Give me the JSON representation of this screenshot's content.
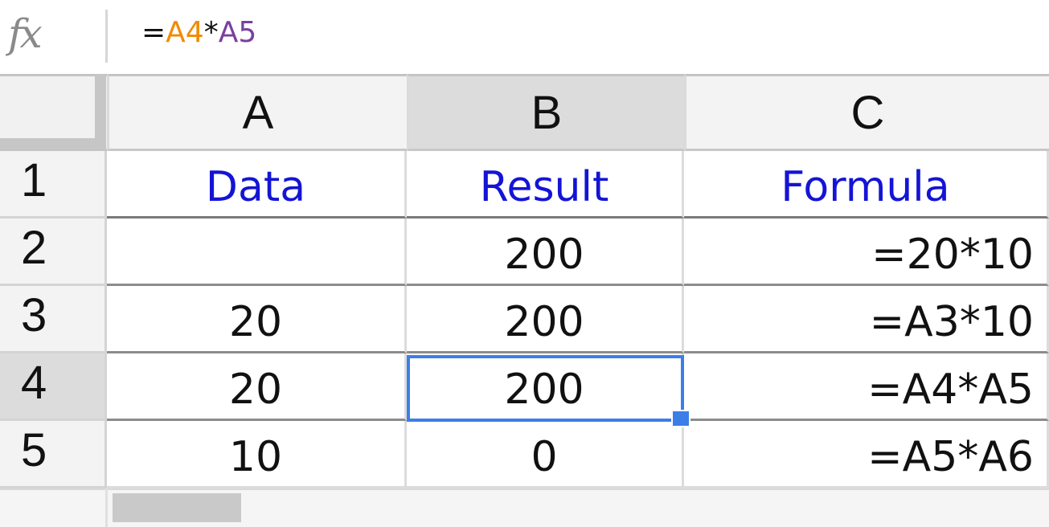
{
  "formula_bar": {
    "icon": "fx-icon",
    "tokens": [
      {
        "text": "=",
        "color": "#111111"
      },
      {
        "text": "A4",
        "color": "#f08a00"
      },
      {
        "text": "*",
        "color": "#111111"
      },
      {
        "text": "A5",
        "color": "#7b3fa0"
      }
    ]
  },
  "columns": [
    "A",
    "B",
    "C"
  ],
  "rows": [
    "1",
    "2",
    "3",
    "4",
    "5"
  ],
  "cells": {
    "A1": "Data",
    "B1": "Result",
    "C1": "Formula",
    "A2": "",
    "B2": "200",
    "C2": "=20*10",
    "A3": "20",
    "B3": "200",
    "C3": "=A3*10",
    "A4": "20",
    "B4": "200",
    "C4": "=A4*A5",
    "A5": "10",
    "B5": "0",
    "C5": "=A5*A6"
  },
  "selected_cell": "B4",
  "colors": {
    "header_text": "#1414d6",
    "selection": "#3c7ee8"
  }
}
